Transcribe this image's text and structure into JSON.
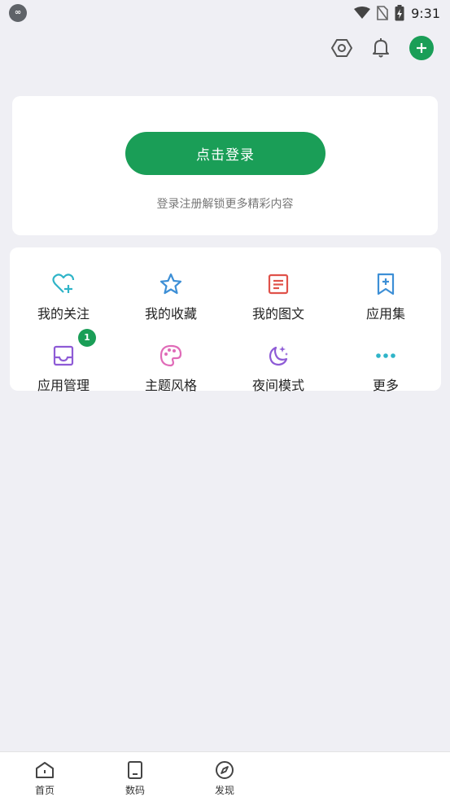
{
  "status_bar": {
    "time": "9:31",
    "left_icon": "app-notification-icon",
    "icons": [
      "wifi-icon",
      "no-sim-icon",
      "battery-charging-icon"
    ]
  },
  "top_bar": {
    "icons": [
      "settings-hexagon-icon",
      "bell-icon",
      "add-icon"
    ],
    "accent_color": "#1a9e57"
  },
  "login": {
    "button_label": "点击登录",
    "hint": "登录注册解锁更多精彩内容"
  },
  "menu": {
    "items": [
      {
        "label": "我的关注",
        "icon": "heart-plus-icon",
        "color": "#2fb4c8"
      },
      {
        "label": "我的收藏",
        "icon": "star-icon",
        "color": "#3d8fd6"
      },
      {
        "label": "我的图文",
        "icon": "article-icon",
        "color": "#e0524a"
      },
      {
        "label": "应用集",
        "icon": "bookmark-plus-icon",
        "color": "#3d8fd6"
      },
      {
        "label": "应用管理",
        "icon": "inbox-icon",
        "color": "#8e5bd6",
        "badge": "1"
      },
      {
        "label": "主题风格",
        "icon": "palette-icon",
        "color": "#e06bb8"
      },
      {
        "label": "夜间模式",
        "icon": "moon-stars-icon",
        "color": "#8e5bd6"
      },
      {
        "label": "更多",
        "icon": "more-dots-icon",
        "color": "#2fb4c8"
      }
    ]
  },
  "bottom_nav": {
    "items": [
      {
        "label": "首页",
        "icon": "home-icon"
      },
      {
        "label": "数码",
        "icon": "tablet-icon"
      },
      {
        "label": "发现",
        "icon": "compass-icon"
      }
    ]
  }
}
